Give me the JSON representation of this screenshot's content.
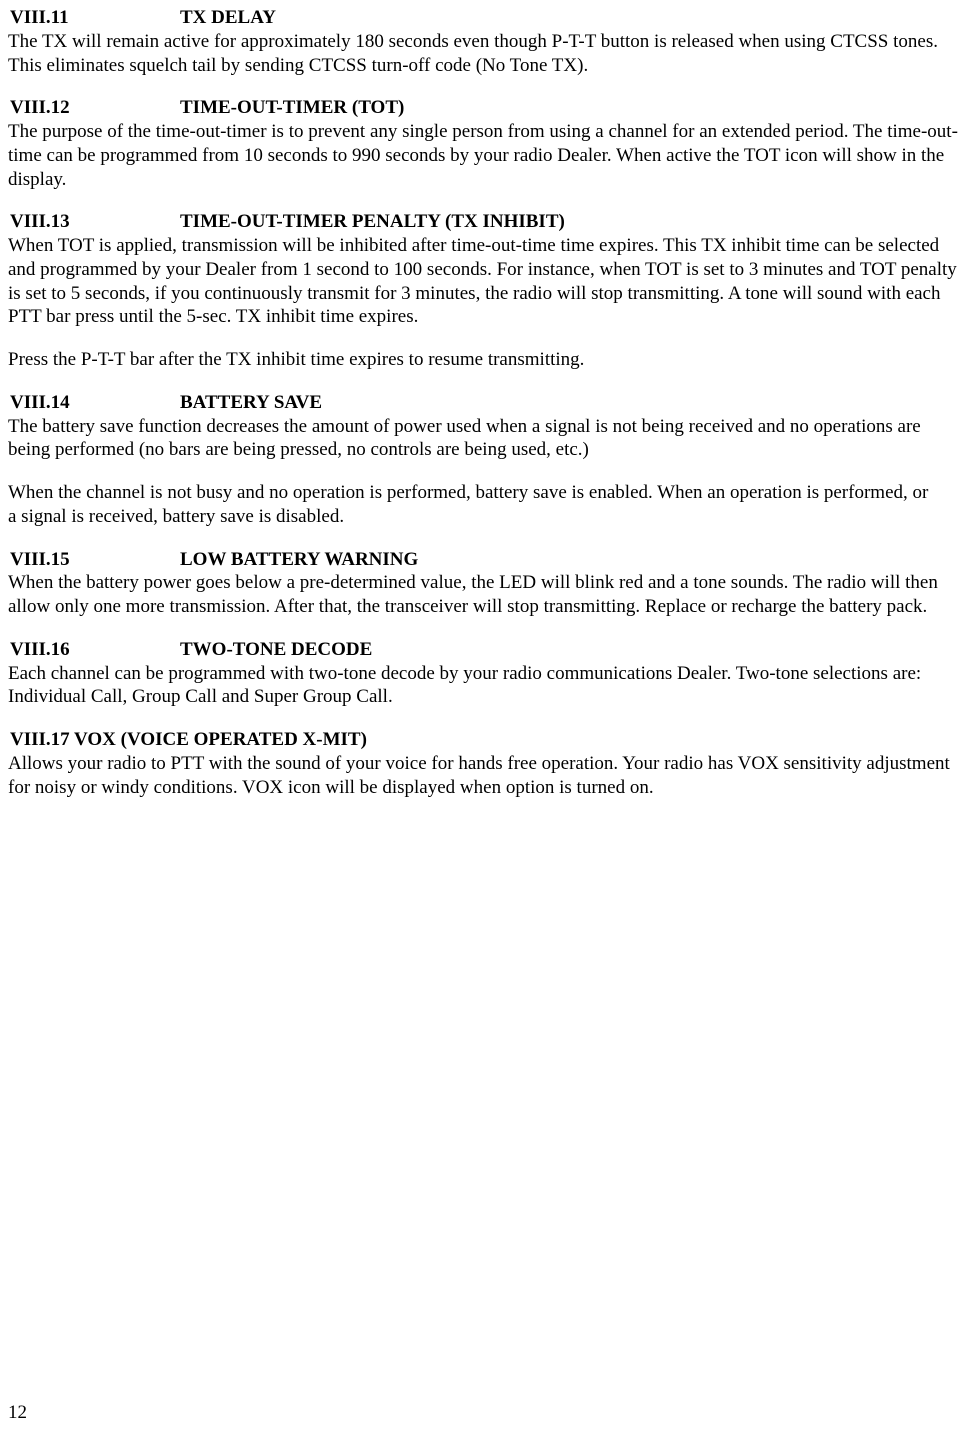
{
  "s11": {
    "num": "VIII.11",
    "title": "TX DELAY",
    "p1": "The TX will remain active for approximately 180 seconds even though P-T-T button is released when using CTCSS tones.",
    "p2": "This eliminates squelch tail by sending CTCSS turn-off code (No Tone TX)."
  },
  "s12": {
    "num": "VIII.12",
    "title": "TIME-OUT-TIMER (TOT)",
    "p1": "The purpose of the time-out-timer is to prevent any single person from using a channel for an extended period. The time-out-time can be programmed from 10 seconds to 990 seconds by your radio Dealer.  When active the TOT icon will show in the display."
  },
  "s13": {
    "num": "VIII.13",
    "title": "TIME-OUT-TIMER PENALTY (TX INHIBIT)",
    "p1": "When TOT is applied, transmission will be inhibited after time-out-time time expires. This TX inhibit time can be selected and programmed by your Dealer from 1 second to 100 seconds. For instance, when TOT is set to 3 minutes and TOT penalty is set to 5 seconds, if you continuously transmit for 3 minutes, the radio will stop transmitting. A tone will sound with each",
    "p2": "PTT bar press until the 5-sec. TX inhibit time expires.",
    "p3": "Press the P-T-T bar after the TX inhibit time expires to resume transmitting."
  },
  "s14": {
    "num": "VIII.14",
    "title": "BATTERY SAVE",
    "p1": "The battery save function decreases the amount of power used when a signal is not being received and no operations are being performed (no bars are being pressed, no controls are being used, etc.)",
    "p2": "When the channel is not busy and no operation is performed, battery save is enabled. When an operation is performed, or",
    "p3": "a signal is received, battery save is disabled."
  },
  "s15": {
    "num": "VIII.15",
    "title": "LOW BATTERY WARNING",
    "p1": "When the battery power goes below a pre-determined value, the LED will blink red and a tone sounds. The radio will then allow only one more transmission. After that, the transceiver will stop transmitting. Replace or recharge the battery pack."
  },
  "s16": {
    "num": "VIII.16",
    "title": "TWO-TONE DECODE",
    "p1": "Each channel can be programmed with two-tone decode by your radio communications Dealer. Two-tone selections are: Individual Call, Group Call and Super Group Call."
  },
  "s17": {
    "heading": "VIII.17 VOX (VOICE OPERATED X-MIT)",
    "p1": "Allows your radio to PTT with the sound of your voice for hands free operation. Your radio has VOX sensitivity adjustment for noisy or windy conditions. VOX icon will be displayed when option is turned on."
  },
  "page_number": "12"
}
